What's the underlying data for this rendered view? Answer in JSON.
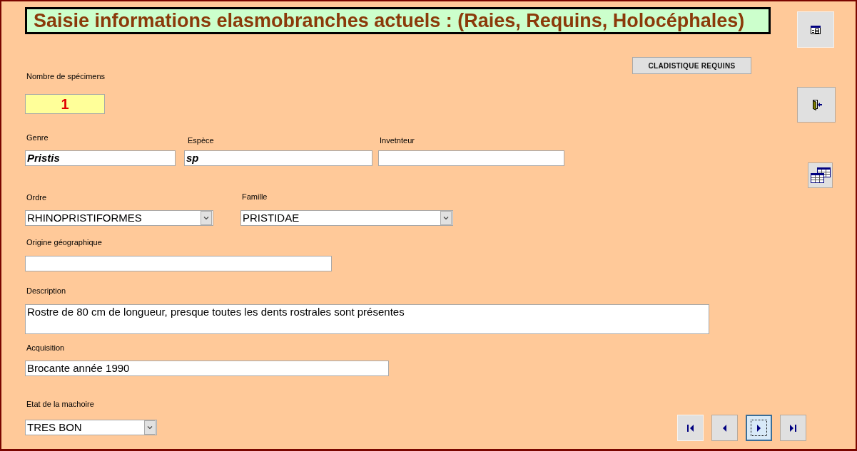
{
  "title": "Saisie informations elasmobranches actuels : (Raies, Requins, Holocéphales)",
  "side_buttons": [
    {
      "kind": "form"
    },
    {
      "kind": "exit"
    },
    {
      "kind": "tables"
    }
  ],
  "cladistics_button": "CLADISTIQUE REQUINS",
  "fields": [
    {
      "kind": "count",
      "label": "Nombre de spécimens",
      "value": "1"
    },
    {
      "kind": "text",
      "label": "Genre",
      "value": "Pristis"
    },
    {
      "kind": "text",
      "label": "Espèce",
      "value": "sp"
    },
    {
      "kind": "text",
      "label": "Invetnteur"
    },
    {
      "kind": "combo",
      "label": "Ordre",
      "value": "RHINOPRISTIFORMES"
    },
    {
      "kind": "combo",
      "label": "Famille",
      "value": "PRISTIDAE"
    },
    {
      "kind": "text",
      "label": "Origine géographique"
    },
    {
      "kind": "memo",
      "label": "Description",
      "value": "Rostre de 80 cm de longueur, presque toutes les dents rostrales sont présentes"
    },
    {
      "kind": "text",
      "label": "Acquisition",
      "value": "Brocante année 1990"
    },
    {
      "kind": "combo",
      "label": "Etat de la machoire",
      "value": "TRES BON"
    }
  ],
  "record_navigation": [
    {
      "kind": "first",
      "focused": false
    },
    {
      "kind": "previous",
      "focused": false
    },
    {
      "kind": "next",
      "focused": true
    },
    {
      "kind": "last",
      "focused": false
    }
  ]
}
